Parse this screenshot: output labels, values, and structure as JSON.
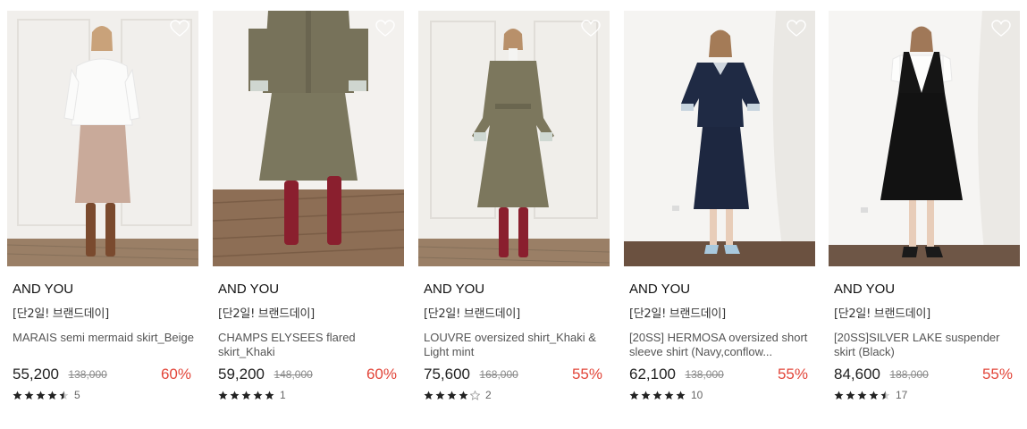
{
  "products": [
    {
      "brand": "AND YOU",
      "promo": "[단2일! 브랜드데이]",
      "name": "MARAIS semi mermaid skirt_Beige",
      "price": "55,200",
      "original_price": "138,000",
      "discount": "60%",
      "rating": 4.5,
      "review_count": "5",
      "image": "model-white-blouse-beige-skirt"
    },
    {
      "brand": "AND YOU",
      "promo": "[단2일! 브랜드데이]",
      "name": "CHAMPS ELYSEES flared skirt_Khaki",
      "price": "59,200",
      "original_price": "148,000",
      "discount": "60%",
      "rating": 5,
      "review_count": "1",
      "image": "model-khaki-skirt-red-boots"
    },
    {
      "brand": "AND YOU",
      "promo": "[단2일! 브랜드데이]",
      "name": "LOUVRE oversized shirt_Khaki & Light mint",
      "price": "75,600",
      "original_price": "168,000",
      "discount": "55%",
      "rating": 4,
      "review_count": "2",
      "image": "model-khaki-shirt-dress"
    },
    {
      "brand": "AND YOU",
      "promo": "[단2일! 브랜드데이]",
      "name": "[20SS] HERMOSA oversized short sleeve shirt (Navy,conflow...",
      "price": "62,100",
      "original_price": "138,000",
      "discount": "55%",
      "rating": 5,
      "review_count": "10",
      "image": "model-navy-set"
    },
    {
      "brand": "AND YOU",
      "promo": "[단2일! 브랜드데이]",
      "name": "[20SS]SILVER LAKE suspender skirt (Black)",
      "price": "84,600",
      "original_price": "188,000",
      "discount": "55%",
      "rating": 4.5,
      "review_count": "17",
      "image": "model-black-suspender-skirt"
    }
  ],
  "colors": {
    "discount": "#e2463a",
    "star": "#222222",
    "star_empty": "#cfcfcf"
  },
  "icons": {
    "wishlist": "heart-outline-icon",
    "rating": "star-icon"
  }
}
